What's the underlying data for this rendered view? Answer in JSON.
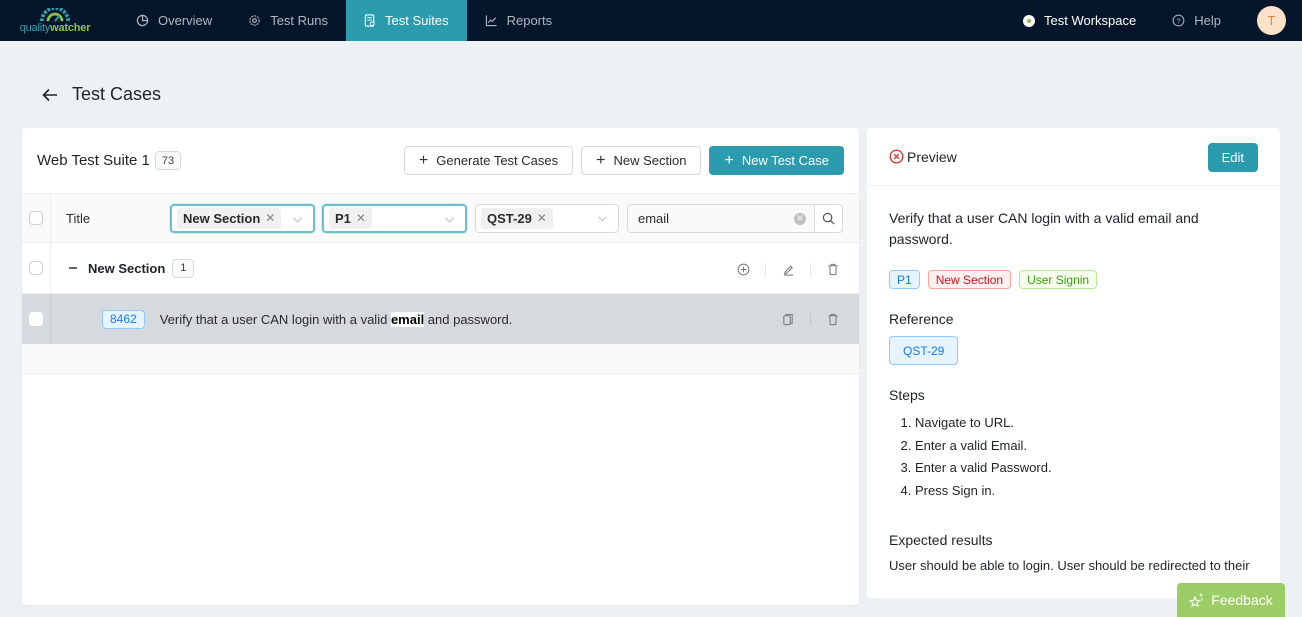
{
  "brand": {
    "part1": "quality",
    "part2": "watcher",
    "accent": "#2a9cae",
    "green": "#8bc34a"
  },
  "nav": {
    "items": [
      {
        "label": "Overview",
        "icon": "pie-chart-icon"
      },
      {
        "label": "Test Runs",
        "icon": "gear-icon"
      },
      {
        "label": "Test Suites",
        "icon": "document-icon",
        "active": true
      },
      {
        "label": "Reports",
        "icon": "line-chart-icon"
      }
    ],
    "workspace": "Test Workspace",
    "help": "Help",
    "avatar_initial": "T"
  },
  "page": {
    "title": "Test Cases"
  },
  "suite": {
    "name": "Web Test Suite 1",
    "count": "73",
    "actions": {
      "generate": "Generate Test Cases",
      "new_section": "New Section",
      "new_case": "New Test Case"
    }
  },
  "filters": {
    "title_header": "Title",
    "section_filter": "New Section",
    "priority_filter": "P1",
    "reference_filter": "QST-29",
    "search_value": "email"
  },
  "sections": [
    {
      "name": "New Section",
      "count": "1",
      "cases": [
        {
          "id": "8462",
          "title_before": "Verify that a user CAN login with a valid ",
          "title_match": "email",
          "title_after": " and password."
        }
      ]
    }
  ],
  "preview": {
    "heading": "Preview",
    "edit_label": "Edit",
    "title": "Verify that a user CAN login with a valid email and password.",
    "tags": [
      {
        "label": "P1",
        "color": "blue"
      },
      {
        "label": "New Section",
        "color": "red"
      },
      {
        "label": "User Signin",
        "color": "green"
      }
    ],
    "reference_heading": "Reference",
    "reference": "QST-29",
    "steps_heading": "Steps",
    "steps": [
      "Navigate to URL.",
      "Enter a valid Email.",
      "Enter a valid Password.",
      "Press Sign in."
    ],
    "expected_heading": "Expected results",
    "expected": "User should be able to login. User should be redirected to their"
  },
  "feedback": {
    "label": "Feedback"
  }
}
